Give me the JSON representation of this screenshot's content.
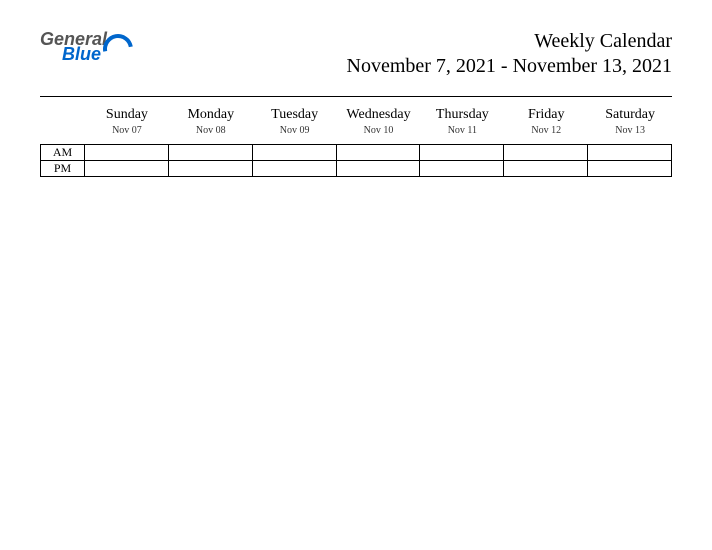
{
  "logo": {
    "text1": "General",
    "text2": "Blue"
  },
  "header": {
    "title": "Weekly Calendar",
    "date_range": "November 7, 2021 - November 13, 2021"
  },
  "periods": [
    "AM",
    "PM"
  ],
  "days": [
    {
      "name": "Sunday",
      "date": "Nov 07"
    },
    {
      "name": "Monday",
      "date": "Nov 08"
    },
    {
      "name": "Tuesday",
      "date": "Nov 09"
    },
    {
      "name": "Wednesday",
      "date": "Nov 10"
    },
    {
      "name": "Thursday",
      "date": "Nov 11"
    },
    {
      "name": "Friday",
      "date": "Nov 12"
    },
    {
      "name": "Saturday",
      "date": "Nov 13"
    }
  ]
}
